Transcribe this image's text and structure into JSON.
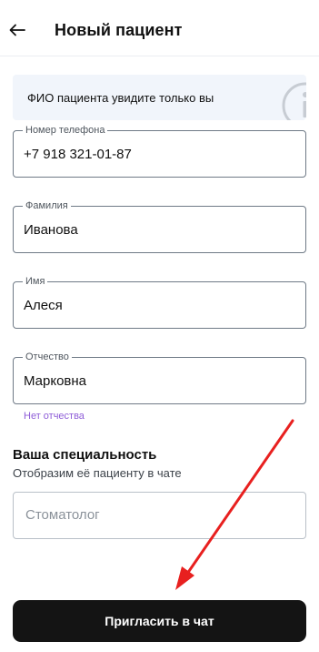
{
  "header": {
    "title": "Новый пациент",
    "back_icon": "arrow-left-icon"
  },
  "info_banner": {
    "text": "ФИО пациента увидите только вы",
    "icon": "info-icon"
  },
  "form": {
    "phone": {
      "label": "Номер телефона",
      "value": "+7 918 321-01-87"
    },
    "last_name": {
      "label": "Фамилия",
      "value": "Иванова"
    },
    "first_name": {
      "label": "Имя",
      "value": "Алеся"
    },
    "patronymic": {
      "label": "Отчество",
      "value": "Марковна"
    },
    "no_patronymic_link": "Нет отчества"
  },
  "specialty": {
    "title": "Ваша специальность",
    "subtitle": "Отобразим её пациенту в чате",
    "placeholder": "Стоматолог"
  },
  "actions": {
    "invite_label": "Пригласить в чат"
  },
  "colors": {
    "accent_link": "#8f5ed8",
    "button_bg": "#141414",
    "banner_bg": "#f1f5fb",
    "annotation_arrow": "#e8201f"
  }
}
